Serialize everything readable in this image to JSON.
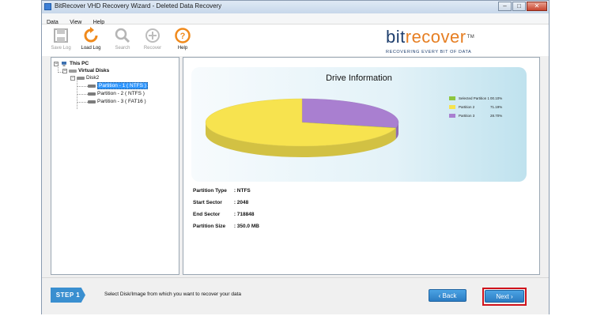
{
  "window": {
    "title": "BitRecover VHD Recovery Wizard - Deleted Data Recovery",
    "controls": {
      "minimize": "–",
      "maximize": "□",
      "close": "✕"
    }
  },
  "menu": [
    "Data",
    "View",
    "Help"
  ],
  "toolbar": {
    "save_log": "Save Log",
    "load_log": "Load Log",
    "search": "Search",
    "recover": "Recover",
    "help": "Help"
  },
  "brand": {
    "bit": "bit",
    "recover": "recover",
    "tm": "TM",
    "tagline": "RECOVERING EVERY BIT OF DATA"
  },
  "tree": {
    "root": "This PC",
    "virtual_disks": "Virtual Disks",
    "disk": "Disk2",
    "partitions": [
      "Partition - 1 ( NTFS )",
      "Partition - 2 ( NTFS )",
      "Partition - 3 ( FAT16 )"
    ]
  },
  "chart_data": {
    "type": "pie",
    "title": "Drive Information",
    "categories": [
      "Selected Partition 1",
      "Partition 2",
      "Partition 3"
    ],
    "values": [
      0.1,
      71.19,
      28.7
    ],
    "labels": [
      "00.10%",
      "71.19%",
      "28.70%"
    ],
    "colors": [
      "#8dc63f",
      "#f7e34f",
      "#a97fd0"
    ],
    "legend": "right"
  },
  "partition_info": {
    "type_label": "Partition Type",
    "type_value": ": NTFS",
    "start_label": "Start Sector",
    "start_value": ": 2048",
    "end_label": "End Sector",
    "end_value": ": 718848",
    "size_label": "Partition Size",
    "size_value": ": 350.0 MB"
  },
  "footer": {
    "step": "STEP 1",
    "instruction": "Select Disk/Image from which you want to recover your data",
    "back": "‹ Back",
    "next": "Next ›"
  },
  "colors": {
    "accent": "#3a8fd0",
    "brand_blue": "#1f3f6e",
    "brand_orange": "#e67e22",
    "highlight_red": "#d0121b"
  }
}
